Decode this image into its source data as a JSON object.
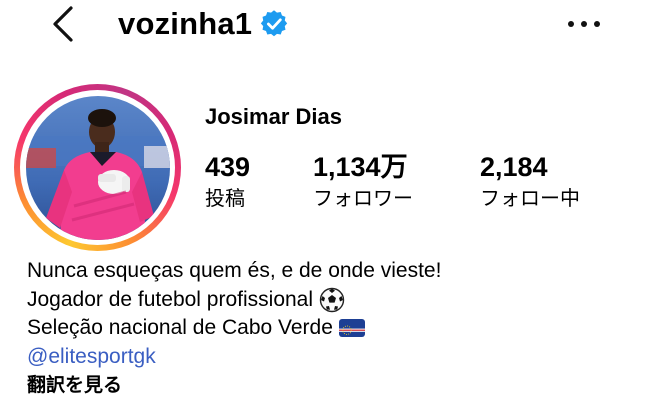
{
  "header": {
    "username": "vozinha1",
    "back_icon": "chevron-left-icon",
    "verified_icon": "verified-badge-icon",
    "more_icon": "more-horizontal-icon"
  },
  "profile": {
    "full_name": "Josimar Dias",
    "ring_colors": [
      "#fdc830",
      "#f5376b",
      "#c13584"
    ]
  },
  "stats": {
    "posts": {
      "value": "439",
      "label": "投稿"
    },
    "followers": {
      "value": "1,134万",
      "label": "フォロワー"
    },
    "following": {
      "value": "2,184",
      "label": "フォロー中"
    }
  },
  "bio": {
    "line1": "Nunca esqueças quem és, e de onde vieste!",
    "line2": "Jogador de futebol profissional",
    "line3": "Seleção nacional de Cabo Verde",
    "link": "@elitesportgk",
    "translate": "翻訳を見る",
    "link_color": "#3a5ec2"
  }
}
